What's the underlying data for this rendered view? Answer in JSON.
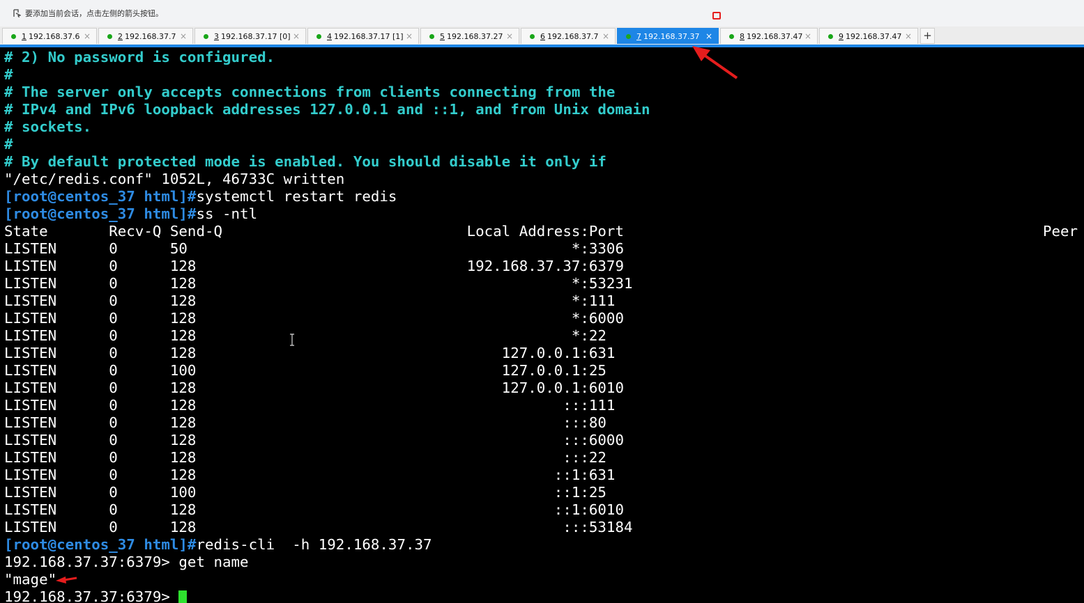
{
  "topbar": {
    "hint": "要添加当前会话，点击左侧的箭头按钮。"
  },
  "tabs": [
    {
      "num": "1",
      "host": "192.168.37.6",
      "active": false
    },
    {
      "num": "2",
      "host": "192.168.37.7",
      "active": false
    },
    {
      "num": "3",
      "host": "192.168.37.17 [0]",
      "active": false
    },
    {
      "num": "4",
      "host": "192.168.37.17 [1]",
      "active": false
    },
    {
      "num": "5",
      "host": "192.168.37.27",
      "active": false
    },
    {
      "num": "6",
      "host": "192.168.37.7",
      "active": false
    },
    {
      "num": "7",
      "host": "192.168.37.37",
      "active": true
    },
    {
      "num": "8",
      "host": "192.168.37.47",
      "active": false
    },
    {
      "num": "9",
      "host": "192.168.37.47",
      "active": false
    }
  ],
  "add_tab": "+",
  "close_glyph": "×",
  "colors": {
    "tab_active": "#1e86e6",
    "status_dot": "#19a619",
    "comment": "#33cccc",
    "prompt": "#2e8be3",
    "cursor": "#2ee22e",
    "annotation": "#e51d1d"
  },
  "terminal": {
    "lines": [
      {
        "style": "comment",
        "text": "# 2) No password is configured."
      },
      {
        "style": "comment",
        "text": "#"
      },
      {
        "style": "comment",
        "text": "# The server only accepts connections from clients connecting from the"
      },
      {
        "style": "comment",
        "text": "# IPv4 and IPv6 loopback addresses 127.0.0.1 and ::1, and from Unix domain"
      },
      {
        "style": "comment",
        "text": "# sockets."
      },
      {
        "style": "comment",
        "text": "#"
      },
      {
        "style": "comment",
        "text": "# By default protected mode is enabled. You should disable it only if"
      },
      {
        "style": "plain",
        "text": "\"/etc/redis.conf\" 1052L, 46733C written"
      },
      {
        "style": "prompt",
        "prompt": "[root@centos_37 html]#",
        "text": "systemctl restart redis"
      },
      {
        "style": "prompt",
        "prompt": "[root@centos_37 html]#",
        "text": "ss -ntl"
      },
      {
        "style": "plain",
        "text": "State       Recv-Q Send-Q                            Local Address:Port                                                Peer Address:Port"
      },
      {
        "style": "plain",
        "text": "LISTEN      0      50                                            *:3306"
      },
      {
        "style": "plain",
        "text": "LISTEN      0      128                               192.168.37.37:6379"
      },
      {
        "style": "plain",
        "text": "LISTEN      0      128                                           *:53231"
      },
      {
        "style": "plain",
        "text": "LISTEN      0      128                                           *:111"
      },
      {
        "style": "plain",
        "text": "LISTEN      0      128                                           *:6000"
      },
      {
        "style": "plain",
        "text": "LISTEN      0      128                                           *:22"
      },
      {
        "style": "plain",
        "text": "LISTEN      0      128                                   127.0.0.1:631"
      },
      {
        "style": "plain",
        "text": "LISTEN      0      100                                   127.0.0.1:25"
      },
      {
        "style": "plain",
        "text": "LISTEN      0      128                                   127.0.0.1:6010"
      },
      {
        "style": "plain",
        "text": "LISTEN      0      128                                          :::111"
      },
      {
        "style": "plain",
        "text": "LISTEN      0      128                                          :::80"
      },
      {
        "style": "plain",
        "text": "LISTEN      0      128                                          :::6000"
      },
      {
        "style": "plain",
        "text": "LISTEN      0      128                                          :::22"
      },
      {
        "style": "plain",
        "text": "LISTEN      0      128                                         ::1:631"
      },
      {
        "style": "plain",
        "text": "LISTEN      0      100                                         ::1:25"
      },
      {
        "style": "plain",
        "text": "LISTEN      0      128                                         ::1:6010"
      },
      {
        "style": "plain",
        "text": "LISTEN      0      128                                          :::53184"
      },
      {
        "style": "prompt",
        "prompt": "[root@centos_37 html]#",
        "text": "redis-cli  -h 192.168.37.37"
      },
      {
        "style": "plain",
        "text": "192.168.37.37:6379> get name"
      },
      {
        "style": "plain",
        "text": "\"mage\""
      },
      {
        "style": "cursor",
        "text": "192.168.37.37:6379> "
      }
    ]
  }
}
